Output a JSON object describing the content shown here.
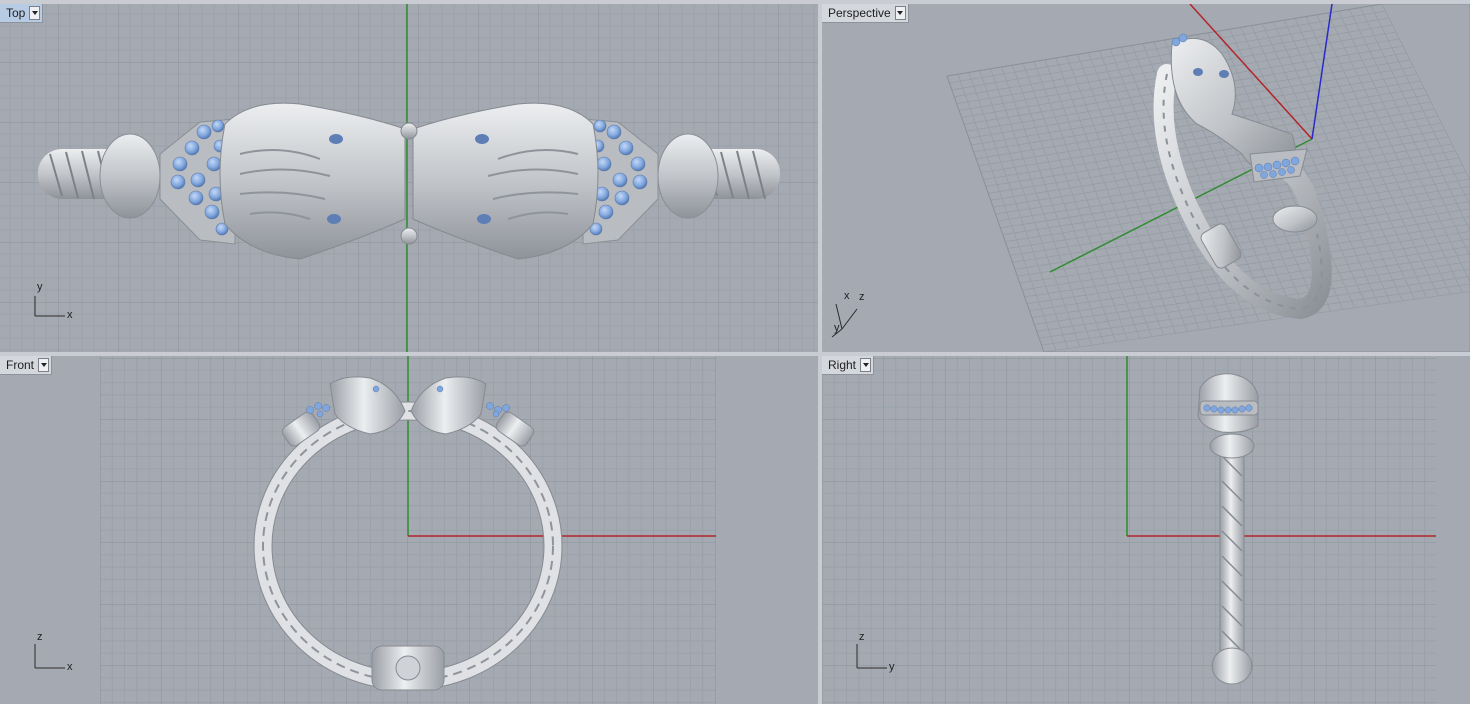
{
  "colors": {
    "viewport_bg": "#a5aab2",
    "grid_minor": "#98a0a8",
    "grid_major": "#8b929b",
    "x_axis": "#b2262a",
    "y_axis": "#2d8c2d",
    "z_axis": "#2a2ac8",
    "metal": "#d3d5d8",
    "metal_shadow": "#8f949b",
    "gem": "#7fa6de",
    "active_tab": "#b7cbe4"
  },
  "icons": {
    "viewport_menu": "chevron-down-icon",
    "axis_widget": "axes-icon"
  },
  "viewports": {
    "top": {
      "label": "Top",
      "active": true,
      "axis_a": "y",
      "axis_b": "x"
    },
    "perspective": {
      "label": "Perspective",
      "active": false,
      "axis_a": "x",
      "axis_b": "z",
      "axis_c": "y"
    },
    "front": {
      "label": "Front",
      "active": false,
      "axis_a": "z",
      "axis_b": "x"
    },
    "right": {
      "label": "Right",
      "active": false,
      "axis_a": "z",
      "axis_b": "y"
    }
  }
}
